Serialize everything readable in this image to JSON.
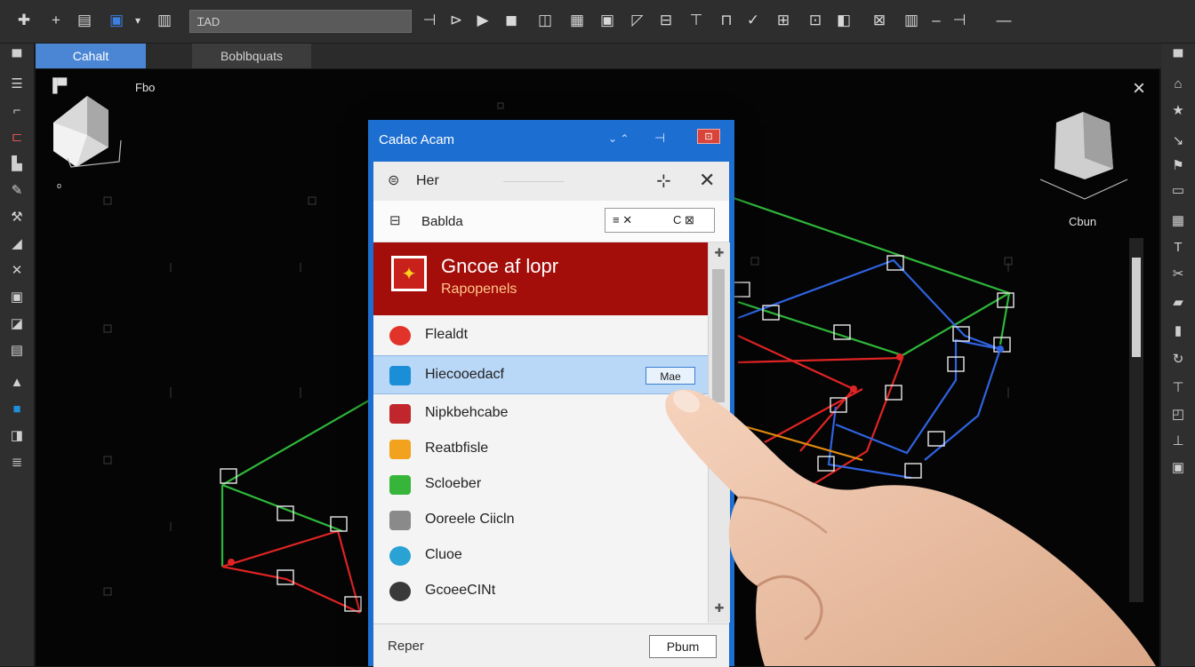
{
  "toolbar": {
    "search_value": "ꞮAD",
    "icons": [
      "move-icon",
      "add-icon",
      "layers-icon",
      "select-icon",
      "dropdown-icon",
      "building-icon",
      "play-icon",
      "record-icon",
      "camera-icon",
      "view-icon",
      "grid-icon",
      "folder-icon",
      "pin-icon",
      "crop-icon",
      "measure-icon",
      "snap-icon",
      "layout-icon",
      "dock-icon",
      "texture-icon",
      "dash-icon",
      "sound-icon",
      "minus-icon"
    ]
  },
  "tabs": {
    "active": "Cahalt",
    "inactive": "Boblbquats"
  },
  "viewport": {
    "label_top_left": "Fbo",
    "label_right": "Cbun",
    "close": "×",
    "accent_green": "#2fb63a",
    "accent_blue": "#2f63e0",
    "accent_red": "#e02424"
  },
  "dialog": {
    "title": "Cadac Acam",
    "close_glyph": "⊡",
    "header_label": "Her",
    "search_label": "Bablda",
    "segment_left": "≡ ✕",
    "segment_right": "C ⊠",
    "banner_title": "Gncoe af lopr",
    "banner_subtitle": "Rapopenels",
    "items": [
      {
        "label": "Flealdt",
        "icon_color": "#e2332a"
      },
      {
        "label": "Hiecooedacf",
        "icon_color": "#1a8fd8",
        "selected": true,
        "mini": "Mae"
      },
      {
        "label": "Nipkbehcabe",
        "icon_color": "#c0262b"
      },
      {
        "label": "Reatbfisle",
        "icon_color": "#f2a21c"
      },
      {
        "label": "Scloeber",
        "icon_color": "#37b53a"
      },
      {
        "label": "Ooreele Ciicln",
        "icon_color": "#8a8a8a"
      },
      {
        "label": "Cluoe",
        "icon_color": "#2aa2d4"
      },
      {
        "label": "GcoeeCINt",
        "icon_color": "#3a3a3a"
      }
    ],
    "footer_label": "Reper",
    "footer_button": "Pbum"
  }
}
